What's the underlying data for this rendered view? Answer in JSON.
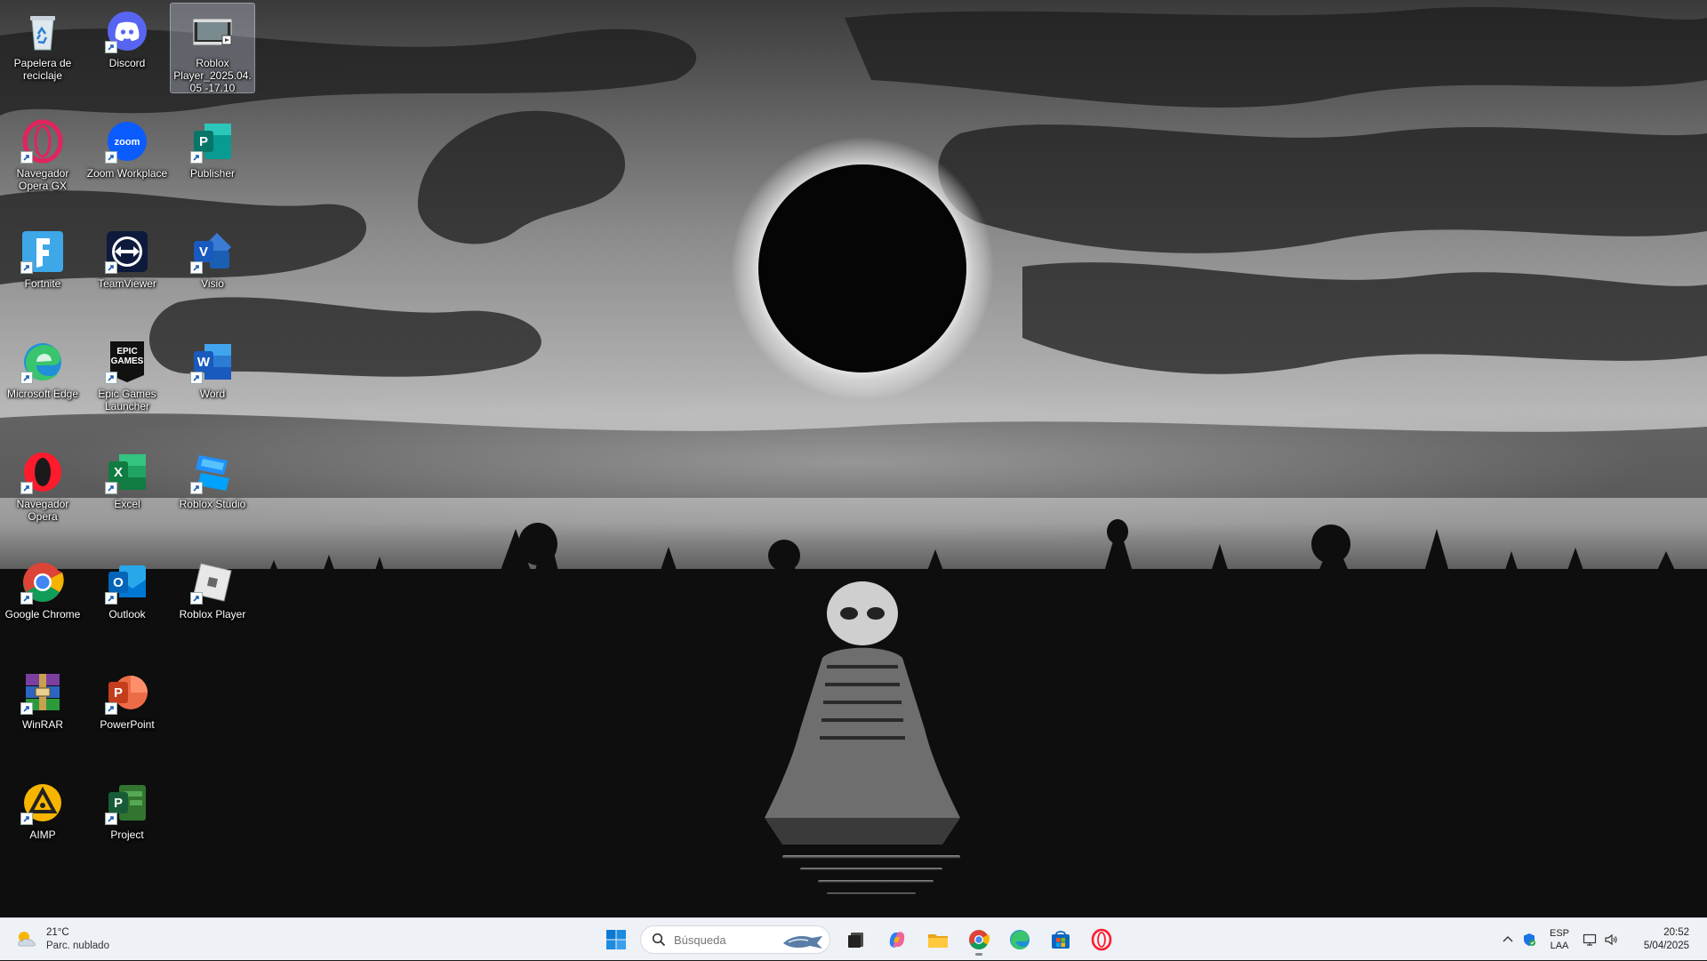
{
  "desktop": {
    "icons": [
      {
        "label": "Papelera de reciclaje",
        "icon": "recycle-bin-icon"
      },
      {
        "label": "Discord",
        "icon": "discord-icon"
      },
      {
        "label": "Roblox Player_2025.04.05 -17.10",
        "icon": "video-file-icon"
      },
      {
        "label": "Navegador Opera GX",
        "icon": "opera-gx-icon"
      },
      {
        "label": "Zoom Workplace",
        "icon": "zoom-icon"
      },
      {
        "label": "Publisher",
        "icon": "publisher-icon"
      },
      {
        "label": "Fortnite",
        "icon": "fortnite-icon"
      },
      {
        "label": "TeamViewer",
        "icon": "teamviewer-icon"
      },
      {
        "label": "Visio",
        "icon": "visio-icon"
      },
      {
        "label": "Microsoft Edge",
        "icon": "edge-icon"
      },
      {
        "label": "Epic Games Launcher",
        "icon": "epic-games-icon"
      },
      {
        "label": "Word",
        "icon": "word-icon"
      },
      {
        "label": "Navegador Opera",
        "icon": "opera-icon"
      },
      {
        "label": "Excel",
        "icon": "excel-icon"
      },
      {
        "label": "Roblox Studio",
        "icon": "roblox-studio-icon"
      },
      {
        "label": "Google Chrome",
        "icon": "chrome-icon"
      },
      {
        "label": "Outlook",
        "icon": "outlook-icon"
      },
      {
        "label": "Roblox Player",
        "icon": "roblox-player-icon"
      },
      {
        "label": "WinRAR",
        "icon": "winrar-icon"
      },
      {
        "label": "PowerPoint",
        "icon": "powerpoint-icon"
      },
      {
        "label": "AIMP",
        "icon": "aimp-icon"
      },
      {
        "label": "Project",
        "icon": "project-icon"
      }
    ],
    "epic_logo_text": "EPIC GAMES",
    "zoom_logo_text": "zoom"
  },
  "taskbar": {
    "weather": {
      "temp": "21°C",
      "desc": "Parc. nublado"
    },
    "search": {
      "placeholder": "Búsqueda"
    },
    "pinned": [
      {
        "name": "start-button",
        "icon": "windows-icon"
      },
      {
        "name": "task-view-button",
        "icon": "task-view-icon"
      },
      {
        "name": "copilot-button",
        "icon": "copilot-icon"
      },
      {
        "name": "file-explorer-button",
        "icon": "folder-icon"
      },
      {
        "name": "chrome-button",
        "icon": "chrome-icon",
        "running": true
      },
      {
        "name": "edge-button",
        "icon": "edge-icon"
      },
      {
        "name": "store-button",
        "icon": "store-icon"
      },
      {
        "name": "opera-button",
        "icon": "opera-icon"
      }
    ],
    "tray": {
      "lang_line1": "ESP",
      "lang_line2": "LAA",
      "time": "20:52",
      "date": "5/04/2025"
    }
  },
  "colors": {
    "taskbar_bg": "#eef1f5",
    "accent_blue": "#0a66c2"
  }
}
